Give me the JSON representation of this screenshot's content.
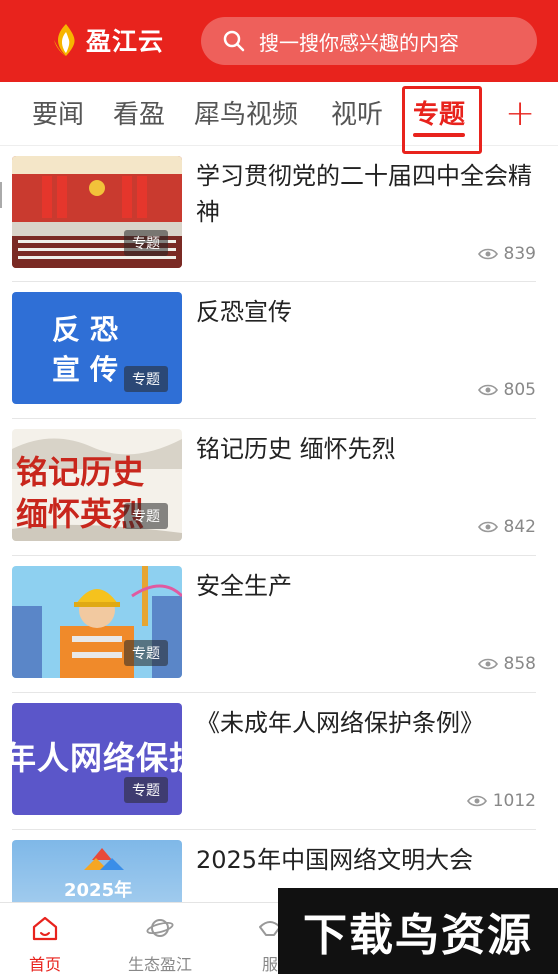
{
  "header": {
    "logo_text": "盈江云",
    "search_placeholder": "搜一搜你感兴趣的内容"
  },
  "tabs": [
    "要闻",
    "看盈",
    "犀鸟视频",
    "视听",
    "专题"
  ],
  "active_tab": "专题",
  "articles": [
    {
      "title": "学习贯彻党的二十届四中全会精神",
      "tag": "专题",
      "views": "839",
      "thumb": "meeting-hall-image"
    },
    {
      "title": "反恐宣传",
      "tag": "专题",
      "views": "805",
      "thumb": "anti-terror-banner",
      "thumb_text": "反 恐\n宣 传"
    },
    {
      "title": "铭记历史  缅怀先烈",
      "tag": "专题",
      "views": "842",
      "thumb": "remember-history-banner",
      "thumb_text": "铭记历史\n缅怀英烈"
    },
    {
      "title": "安全生产",
      "tag": "专题",
      "views": "858",
      "thumb": "safety-worker-illustration"
    },
    {
      "title": "《未成年人网络保护条例》",
      "tag": "专题",
      "views": "1012",
      "thumb": "minor-protection-banner",
      "thumb_text": "年人网络保护"
    },
    {
      "title": "2025年中国网络文明大会",
      "tag": "专题",
      "views": "",
      "thumb": "network-civilization-banner",
      "thumb_text": "2025年"
    }
  ],
  "bottom_nav": [
    {
      "label": "首页",
      "icon": "home-icon",
      "active": true
    },
    {
      "label": "生态盈江",
      "icon": "planet-icon",
      "active": false
    },
    {
      "label": "服",
      "icon": "service-icon",
      "active": false
    }
  ],
  "watermark": "下载鸟资源",
  "colors": {
    "brand_red": "#e8231d"
  }
}
